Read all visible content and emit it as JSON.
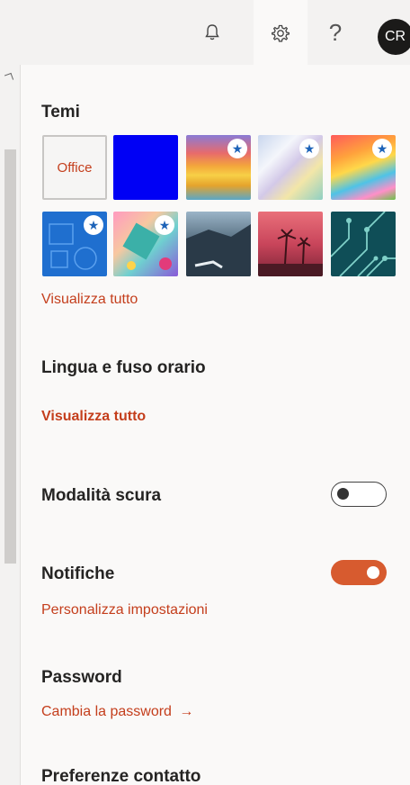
{
  "topbar": {
    "notifications_icon": "bell-icon",
    "settings_icon": "gear-icon",
    "help_label": "?",
    "avatar_initials": "CR"
  },
  "panel": {
    "themes": {
      "title": "Temi",
      "office_label": "Office",
      "view_all": "Visualizza tutto",
      "premium_icon": "star-badge-icon"
    },
    "language": {
      "title": "Lingua e fuso orario",
      "view_all": "Visualizza tutto"
    },
    "dark_mode": {
      "title": "Modalità scura",
      "enabled": false
    },
    "notifications": {
      "title": "Notifiche",
      "enabled": true,
      "customize": "Personalizza impostazioni"
    },
    "password": {
      "title": "Password",
      "change": "Cambia la password",
      "arrow": "→"
    },
    "contact": {
      "title": "Preferenze contatto"
    }
  },
  "colors": {
    "accent": "#c43e1c",
    "toggle_on": "#d75b2f"
  }
}
